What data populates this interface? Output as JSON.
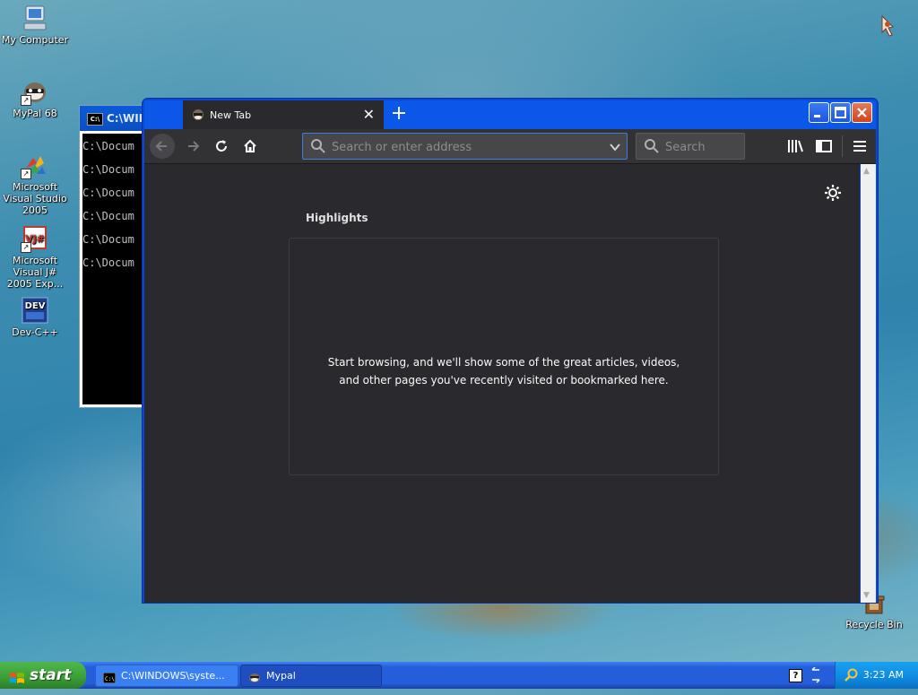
{
  "desktop": {
    "icons": [
      {
        "label": "My Computer"
      },
      {
        "label": "MyPal 68"
      },
      {
        "label": "Microsoft Visual Studio 2005"
      },
      {
        "label": "Microsoft Visual J# 2005 Exp..."
      },
      {
        "label": "Dev-C++"
      },
      {
        "label": "Recycle Bin"
      }
    ]
  },
  "console": {
    "title": "C:\\WIN",
    "lines": [
      "C:\\Docum",
      "C:\\Docum",
      "C:\\Docum",
      "C:\\Docum",
      "C:\\Docum",
      "C:\\Docum"
    ]
  },
  "browser": {
    "tab_title": "New Tab",
    "url_placeholder": "Search or enter address",
    "search_placeholder": "Search",
    "highlights_title": "Highlights",
    "highlights_message": "Start browsing, and we'll show some of the great articles, videos, and other pages you've recently visited or bookmarked here."
  },
  "taskbar": {
    "start_label": "start",
    "tasks": [
      {
        "label": "C:\\WINDOWS\\syste..."
      },
      {
        "label": "Mypal"
      }
    ],
    "clock": "3:23 AM"
  },
  "colors": {
    "accent": "#3d7fdc",
    "browser_bg": "#2a2a2e",
    "toolbar_bg": "#323234",
    "xp_blue": "#245edb"
  }
}
